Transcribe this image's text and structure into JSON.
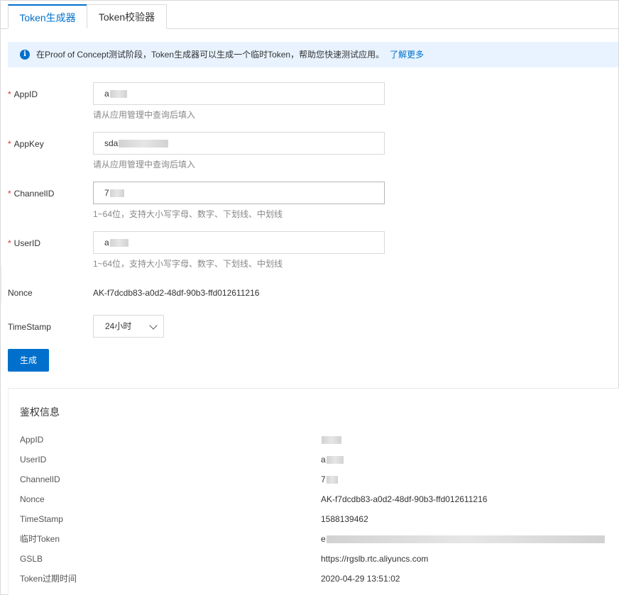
{
  "tabs": [
    {
      "label": "Token生成器",
      "active": true
    },
    {
      "label": "Token校验器",
      "active": false
    }
  ],
  "banner": {
    "icon": "info-icon",
    "text": "在Proof of Concept测试阶段，Token生成器可以生成一个临时Token，帮助您快速测试应用。",
    "link": "了解更多"
  },
  "form": {
    "required_mark": "*",
    "appid": {
      "label": "AppID",
      "value": "a",
      "hint": "请从应用管理中查询后填入"
    },
    "appkey": {
      "label": "AppKey",
      "value": "sda",
      "hint": "请从应用管理中查询后填入"
    },
    "channelid": {
      "label": "ChannelID",
      "value": "7",
      "hint": "1~64位，支持大小写字母、数字、下划线、中划线"
    },
    "userid": {
      "label": "UserID",
      "value": "a",
      "hint": "1~64位，支持大小写字母、数字、下划线、中划线"
    },
    "nonce": {
      "label": "Nonce",
      "value": "AK-f7dcdb83-a0d2-48df-90b3-ffd012611216"
    },
    "timestamp": {
      "label": "TimeStamp",
      "selected": "24小时"
    },
    "generate_button": "生成"
  },
  "result": {
    "title": "鉴权信息",
    "rows": [
      {
        "label": "AppID",
        "value": ""
      },
      {
        "label": "UserID",
        "value": "a"
      },
      {
        "label": "ChannelID",
        "value": "7"
      },
      {
        "label": "Nonce",
        "value": "AK-f7dcdb83-a0d2-48df-90b3-ffd012611216"
      },
      {
        "label": "TimeStamp",
        "value": "1588139462"
      },
      {
        "label": "临时Token",
        "value": "e"
      },
      {
        "label": "GSLB",
        "value": "https://rgslb.rtc.aliyuncs.com"
      },
      {
        "label": "Token过期时间",
        "value": "2020-04-29 13:51:02"
      }
    ]
  },
  "colors": {
    "accent": "#0070cc",
    "banner_bg": "#e8f3ff",
    "required": "#d93026"
  }
}
